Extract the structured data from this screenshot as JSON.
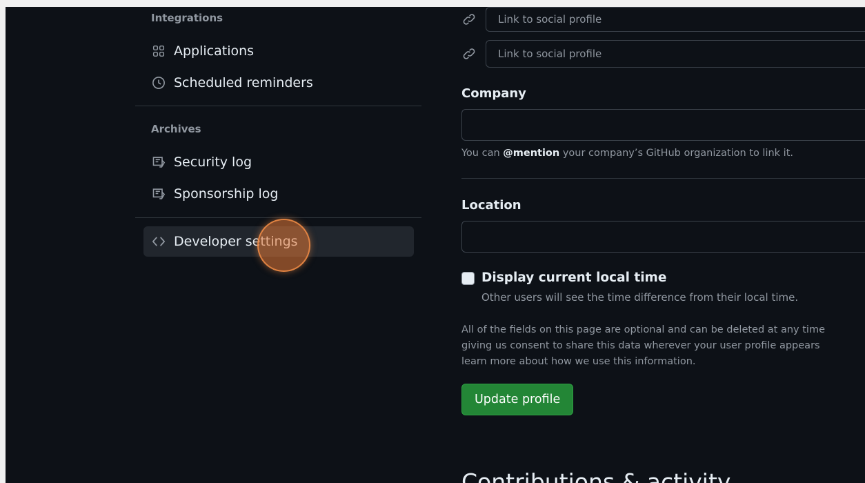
{
  "sidebar": {
    "integrations_heading": "Integrations",
    "archives_heading": "Archives",
    "items": [
      {
        "label": "Applications",
        "icon": "apps-icon"
      },
      {
        "label": "Scheduled reminders",
        "icon": "clock-icon"
      },
      {
        "label": "Security log",
        "icon": "log-icon"
      },
      {
        "label": "Sponsorship log",
        "icon": "log-icon"
      },
      {
        "label": "Developer settings",
        "icon": "code-icon"
      }
    ]
  },
  "profile_form": {
    "social_placeholder_1": "Link to social profile",
    "social_placeholder_2": "Link to social profile",
    "company_label": "Company",
    "company_value": "",
    "company_note_prefix": "You can ",
    "company_note_mention": "@mention",
    "company_note_suffix": " your company’s GitHub organization to link it.",
    "location_label": "Location",
    "location_value": "",
    "local_time_label": "Display current local time",
    "local_time_hint": "Other users will see the time difference from their local time.",
    "local_time_checked": false,
    "optional_note_line1": "All of the fields on this page are optional and can be deleted at any time",
    "optional_note_line2": "giving us consent to share this data wherever your user profile appears",
    "optional_note_line3": "learn more about how we use this information.",
    "update_button": "Update profile",
    "next_section_heading": "Contributions & activity"
  },
  "colors": {
    "background": "#0d1117",
    "active_item": "#21262d",
    "primary_button": "#238636",
    "click_indicator": "#e47837"
  }
}
